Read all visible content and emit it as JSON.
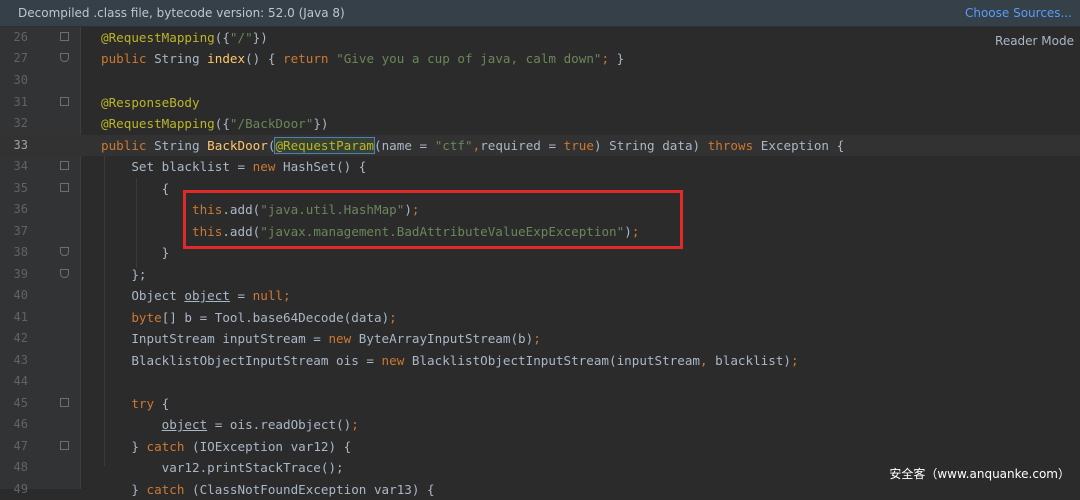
{
  "banner": {
    "text": "Decompiled .class file, bytecode version: 52.0 (Java 8)",
    "action_label": "Choose Sources..."
  },
  "reader_mode_label": "Reader Mode",
  "watermark": "安全客（www.anquanke.com）",
  "active_line": "33",
  "lines": [
    {
      "num": "26",
      "text": "@RequestMapping({\"/\"})"
    },
    {
      "num": "27",
      "text": "public String index() { return \"Give you a cup of java, calm down\"; }"
    },
    {
      "num": "30",
      "text": ""
    },
    {
      "num": "31",
      "text": "@ResponseBody"
    },
    {
      "num": "32",
      "text": "@RequestMapping({\"/BackDoor\"})"
    },
    {
      "num": "33",
      "text": "public String BackDoor(@RequestParam(name = \"ctf\",required = true) String data) throws Exception {"
    },
    {
      "num": "34",
      "text": "    Set blacklist = new HashSet() {"
    },
    {
      "num": "35",
      "text": "        {"
    },
    {
      "num": "36",
      "text": "            this.add(\"java.util.HashMap\");"
    },
    {
      "num": "37",
      "text": "            this.add(\"javax.management.BadAttributeValueExpException\");"
    },
    {
      "num": "38",
      "text": "        }"
    },
    {
      "num": "39",
      "text": "    };"
    },
    {
      "num": "40",
      "text": "    Object object = null;"
    },
    {
      "num": "41",
      "text": "    byte[] b = Tool.base64Decode(data);"
    },
    {
      "num": "42",
      "text": "    InputStream inputStream = new ByteArrayInputStream(b);"
    },
    {
      "num": "43",
      "text": "    BlacklistObjectInputStream ois = new BlacklistObjectInputStream(inputStream, blacklist);"
    },
    {
      "num": "44",
      "text": ""
    },
    {
      "num": "45",
      "text": "    try {"
    },
    {
      "num": "46",
      "text": "        object = ois.readObject();"
    },
    {
      "num": "47",
      "text": "    } catch (IOException var12) {"
    },
    {
      "num": "48",
      "text": "        var12.printStackTrace();"
    },
    {
      "num": "49",
      "text": "    } catch (ClassNotFoundException var13) {"
    }
  ]
}
